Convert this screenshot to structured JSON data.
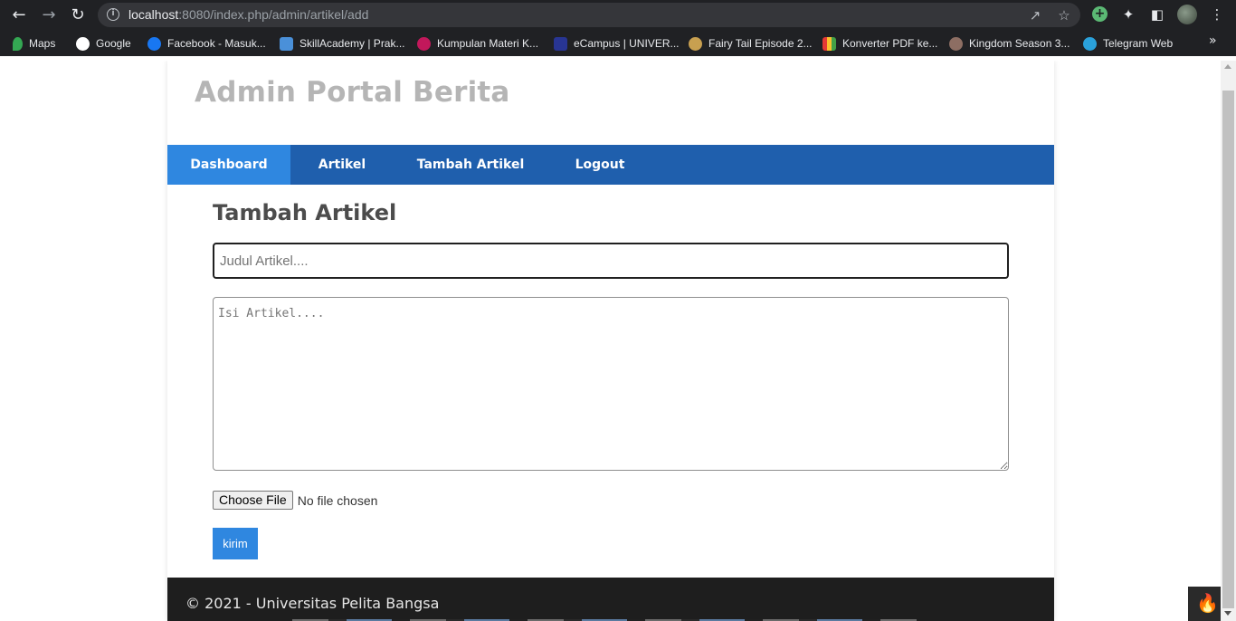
{
  "browser": {
    "url_host": "localhost",
    "url_rest": ":8080/index.php/admin/artikel/add",
    "icons": {
      "back": "back-arrow-icon",
      "forward": "forward-arrow-icon",
      "reload": "reload-icon",
      "info": "info-icon",
      "share": "share-icon",
      "star": "star-icon",
      "extension_add": "plus-circle-icon",
      "extensions": "puzzle-icon",
      "side_panel": "side-panel-icon",
      "menu": "kebab-menu-icon"
    }
  },
  "bookmarks": [
    {
      "label": "Maps",
      "color": "#34a853"
    },
    {
      "label": "Google",
      "color": "#ffffff"
    },
    {
      "label": "Facebook - Masuk...",
      "color": "#1877f2"
    },
    {
      "label": "SkillAcademy | Prak...",
      "color": "#4a90d9"
    },
    {
      "label": "Kumpulan Materi K...",
      "color": "#c2185b"
    },
    {
      "label": "eCampus | UNIVER...",
      "color": "#283593"
    },
    {
      "label": "Fairy Tail Episode 2...",
      "color": "#c8a050"
    },
    {
      "label": "Konverter PDF ke...",
      "color": "#e53935"
    },
    {
      "label": "Kingdom Season 3...",
      "color": "#8d6e63"
    },
    {
      "label": "Telegram Web",
      "color": "#2aa1da"
    }
  ],
  "site": {
    "title": "Admin Portal Berita",
    "menu": [
      {
        "label": "Dashboard",
        "active": true
      },
      {
        "label": "Artikel",
        "active": false
      },
      {
        "label": "Tambah Artikel",
        "active": false
      },
      {
        "label": "Logout",
        "active": false
      }
    ],
    "colors": {
      "menu_bg": "#1f5fad",
      "menu_active": "#2f87e0",
      "button": "#2f87e0",
      "footer_bg": "#1e1e1e"
    }
  },
  "form": {
    "heading": "Tambah Artikel",
    "judul_placeholder": "Judul Artikel....",
    "judul_value": "",
    "isi_placeholder": "Isi Artikel....",
    "isi_value": "",
    "file_button": "Choose File",
    "file_status": "No file chosen",
    "submit_label": "kirim"
  },
  "footer": {
    "text": "© 2021 - Universitas Pelita Bangsa"
  }
}
